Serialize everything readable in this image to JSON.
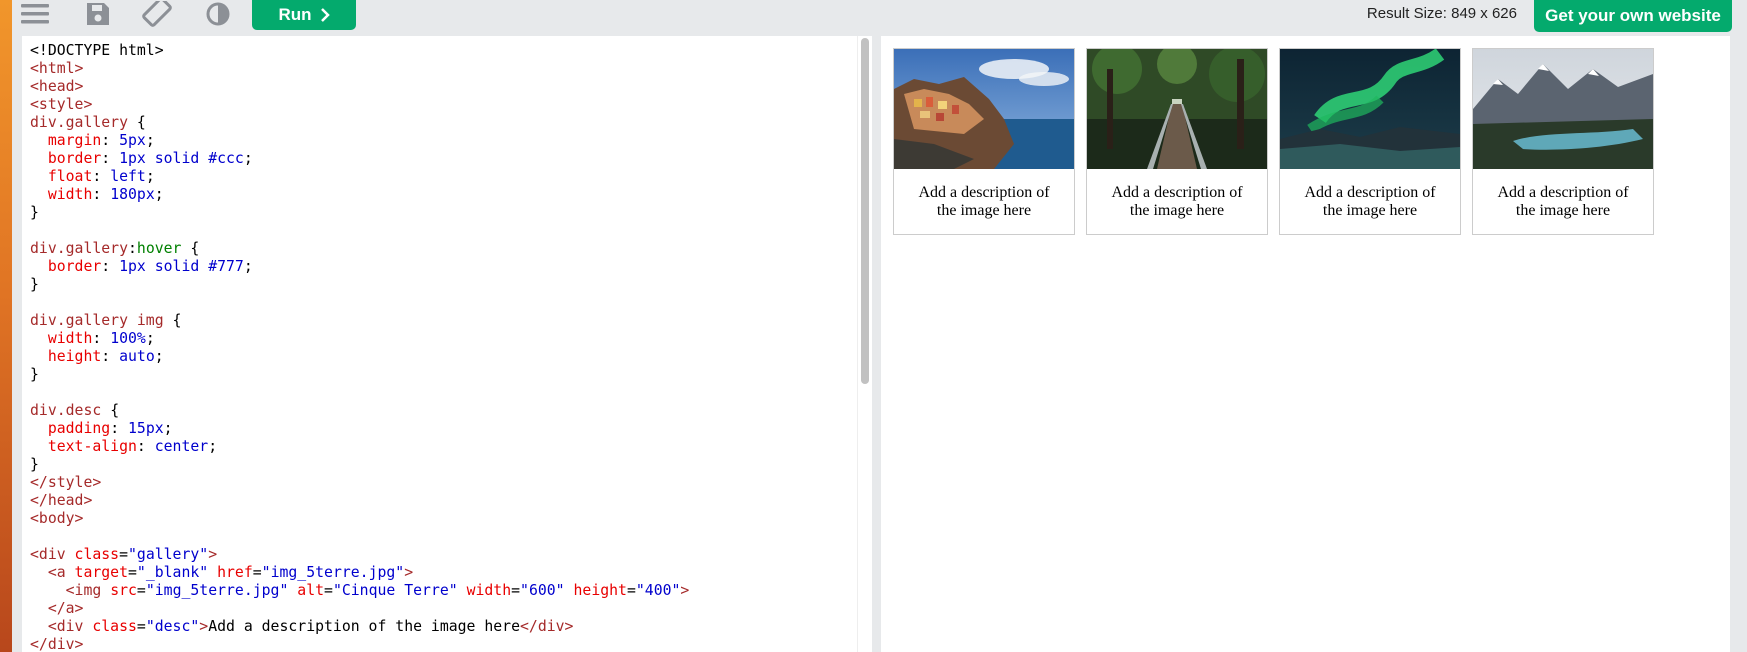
{
  "toolbar": {
    "icons": [
      "menu-icon",
      "save-icon",
      "rotate-icon",
      "contrast-icon"
    ],
    "run_label": "Run",
    "result_size": "Result Size: 849 x 626",
    "own_site_label": "Get your own website"
  },
  "colors": {
    "accent": "#04aa6d",
    "tag": "#a52a2a",
    "attr": "#e80000",
    "value": "#0000cd",
    "pseudo": "#008000"
  },
  "gallery": [
    {
      "image": "Cinque Terre",
      "desc": "Add a description of the image here"
    },
    {
      "image": "Forest bridge",
      "desc": "Add a description of the image here"
    },
    {
      "image": "Northern lights",
      "desc": "Add a description of the image here"
    },
    {
      "image": "Mountains lake",
      "desc": "Add a description of the image here"
    }
  ],
  "code_lines": [
    [
      [
        "<!DOCTYPE html>",
        "t-plain"
      ]
    ],
    [
      [
        "<html>",
        "t-tag"
      ]
    ],
    [
      [
        "<head>",
        "t-tag"
      ]
    ],
    [
      [
        "<style>",
        "t-tag"
      ]
    ],
    [
      [
        "div.gallery",
        "t-sel"
      ],
      [
        " {",
        "t-plain"
      ]
    ],
    [
      [
        "  margin",
        "t-prop"
      ],
      [
        ": ",
        "t-plain"
      ],
      [
        "5px",
        "t-val"
      ],
      [
        ";",
        "t-plain"
      ]
    ],
    [
      [
        "  border",
        "t-prop"
      ],
      [
        ": ",
        "t-plain"
      ],
      [
        "1px solid #ccc",
        "t-val"
      ],
      [
        ";",
        "t-plain"
      ]
    ],
    [
      [
        "  float",
        "t-prop"
      ],
      [
        ": ",
        "t-plain"
      ],
      [
        "left",
        "t-val"
      ],
      [
        ";",
        "t-plain"
      ]
    ],
    [
      [
        "  width",
        "t-prop"
      ],
      [
        ": ",
        "t-plain"
      ],
      [
        "180px",
        "t-val"
      ],
      [
        ";",
        "t-plain"
      ]
    ],
    [
      [
        "}",
        "t-plain"
      ]
    ],
    [
      [
        "",
        "t-plain"
      ]
    ],
    [
      [
        "div.gallery",
        "t-sel"
      ],
      [
        ":",
        "t-plain"
      ],
      [
        "hover",
        "t-pseudo"
      ],
      [
        " {",
        "t-plain"
      ]
    ],
    [
      [
        "  border",
        "t-prop"
      ],
      [
        ": ",
        "t-plain"
      ],
      [
        "1px solid #777",
        "t-val"
      ],
      [
        ";",
        "t-plain"
      ]
    ],
    [
      [
        "}",
        "t-plain"
      ]
    ],
    [
      [
        "",
        "t-plain"
      ]
    ],
    [
      [
        "div.gallery img",
        "t-sel"
      ],
      [
        " {",
        "t-plain"
      ]
    ],
    [
      [
        "  width",
        "t-prop"
      ],
      [
        ": ",
        "t-plain"
      ],
      [
        "100%",
        "t-val"
      ],
      [
        ";",
        "t-plain"
      ]
    ],
    [
      [
        "  height",
        "t-prop"
      ],
      [
        ": ",
        "t-plain"
      ],
      [
        "auto",
        "t-val"
      ],
      [
        ";",
        "t-plain"
      ]
    ],
    [
      [
        "}",
        "t-plain"
      ]
    ],
    [
      [
        "",
        "t-plain"
      ]
    ],
    [
      [
        "div.desc",
        "t-sel"
      ],
      [
        " {",
        "t-plain"
      ]
    ],
    [
      [
        "  padding",
        "t-prop"
      ],
      [
        ": ",
        "t-plain"
      ],
      [
        "15px",
        "t-val"
      ],
      [
        ";",
        "t-plain"
      ]
    ],
    [
      [
        "  text-align",
        "t-prop"
      ],
      [
        ": ",
        "t-plain"
      ],
      [
        "center",
        "t-val"
      ],
      [
        ";",
        "t-plain"
      ]
    ],
    [
      [
        "}",
        "t-plain"
      ]
    ],
    [
      [
        "</style>",
        "t-tag"
      ]
    ],
    [
      [
        "</head>",
        "t-tag"
      ]
    ],
    [
      [
        "<body>",
        "t-tag"
      ]
    ],
    [
      [
        "",
        "t-plain"
      ]
    ],
    [
      [
        "<div ",
        "t-tag"
      ],
      [
        "class",
        "t-attr"
      ],
      [
        "=",
        "t-plain"
      ],
      [
        "\"gallery\"",
        "t-val"
      ],
      [
        ">",
        "t-tag"
      ]
    ],
    [
      [
        "  <a ",
        "t-tag"
      ],
      [
        "target",
        "t-attr"
      ],
      [
        "=",
        "t-plain"
      ],
      [
        "\"_blank\"",
        "t-val"
      ],
      [
        " href",
        "t-attr"
      ],
      [
        "=",
        "t-plain"
      ],
      [
        "\"img_5terre.jpg\"",
        "t-val"
      ],
      [
        ">",
        "t-tag"
      ]
    ],
    [
      [
        "    <img ",
        "t-tag"
      ],
      [
        "src",
        "t-attr"
      ],
      [
        "=",
        "t-plain"
      ],
      [
        "\"img_5terre.jpg\"",
        "t-val"
      ],
      [
        " alt",
        "t-attr"
      ],
      [
        "=",
        "t-plain"
      ],
      [
        "\"Cinque Terre\"",
        "t-val"
      ],
      [
        " width",
        "t-attr"
      ],
      [
        "=",
        "t-plain"
      ],
      [
        "\"600\"",
        "t-val"
      ],
      [
        " height",
        "t-attr"
      ],
      [
        "=",
        "t-plain"
      ],
      [
        "\"400\"",
        "t-val"
      ],
      [
        ">",
        "t-tag"
      ]
    ],
    [
      [
        "  </a>",
        "t-tag"
      ]
    ],
    [
      [
        "  <div ",
        "t-tag"
      ],
      [
        "class",
        "t-attr"
      ],
      [
        "=",
        "t-plain"
      ],
      [
        "\"desc\"",
        "t-val"
      ],
      [
        ">",
        "t-tag"
      ],
      [
        "Add a description of the image here",
        "t-plain"
      ],
      [
        "</div>",
        "t-tag"
      ]
    ],
    [
      [
        "</div>",
        "t-tag"
      ]
    ]
  ]
}
